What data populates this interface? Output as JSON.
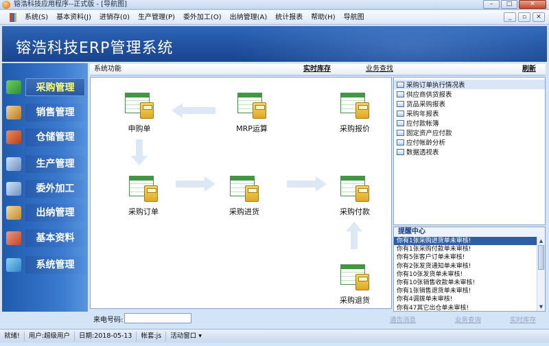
{
  "window": {
    "title": "镕浩科技应用程序--正式版 - [导航图]",
    "controls": [
      "–",
      "□",
      "✕"
    ]
  },
  "menubar": {
    "items": [
      "系统(S)",
      "基本资料(J)",
      "进销存(0)",
      "生产管理(P)",
      "委外加工(O)",
      "出纳管理(A)",
      "统计报表",
      "帮助(H)",
      "导航图"
    ],
    "mdi_controls": [
      "_",
      "▫",
      "✕"
    ]
  },
  "banner": {
    "title": "镕浩科技ERP管理系统"
  },
  "sidebar": {
    "items": [
      {
        "label": "采购管理",
        "icon": "purchase-icon",
        "active": true
      },
      {
        "label": "销售管理",
        "icon": "sales-icon",
        "active": false
      },
      {
        "label": "仓储管理",
        "icon": "warehouse-icon",
        "active": false
      },
      {
        "label": "生产管理",
        "icon": "production-icon",
        "active": false
      },
      {
        "label": "委外加工",
        "icon": "outsource-icon",
        "active": false
      },
      {
        "label": "出纳管理",
        "icon": "cashier-icon",
        "active": false
      },
      {
        "label": "基本资料",
        "icon": "basic-data-icon",
        "active": false
      },
      {
        "label": "系统管理",
        "icon": "system-icon",
        "active": false
      }
    ]
  },
  "content_header": {
    "system_functions": "系统功能",
    "realtime_stock": "实时库存",
    "business_query": "业务查找",
    "refresh": "刷新"
  },
  "workflow": {
    "nodes": {
      "requisition": "申购单",
      "mrp": "MRP运算",
      "quote": "采购报价",
      "order": "采购订单",
      "receipt": "采购进货",
      "payment": "采购付款",
      "return": "采购退货"
    }
  },
  "reports": {
    "items": [
      "采购订单执行情况表",
      "供应商供货报表",
      "货品采购报表",
      "采购年报表",
      "应付款帐簿",
      "固定资产应付款",
      "应付帐龄分析",
      "数据透视表"
    ]
  },
  "reminder": {
    "title": "提醒中心",
    "items": [
      "你有1张采购进货单未审核!",
      "你有1张采购付款单未审核!",
      "你有5张客户订单未审核!",
      "你有2张发货通知单未审核!",
      "你有10张发货单未审核!",
      "你有10张销售收款单未审核!",
      "你有1张销售退货单未审核!",
      "你有4调拨单未审核!",
      "你有47其它出仓单未审核!"
    ]
  },
  "bottom": {
    "caller_label": "来电号码:",
    "caller_value": "",
    "links": [
      "通告消息",
      "业务查询",
      "实时库存"
    ]
  },
  "statusbar": {
    "ready": "就绪!",
    "user": "用户:超级用户",
    "date": "日期:2018-05-13",
    "account": "帐套:js",
    "active_window": "活动窗口 ▾"
  },
  "colors": {
    "banner": "#1f4f9e",
    "sidebar": "#2a63b8",
    "active_label": "#ffff66",
    "selection": "#2f5ea8"
  }
}
